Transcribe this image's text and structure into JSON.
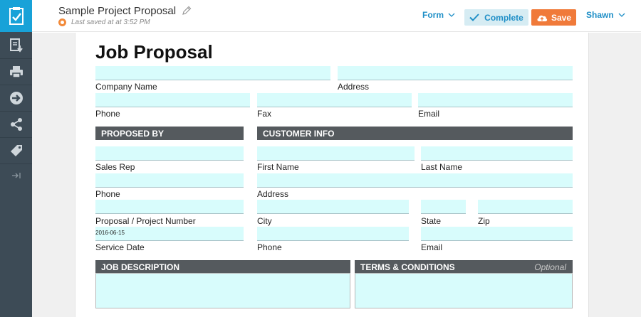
{
  "app": {
    "brand_color": "#18a2d8",
    "sidebar_color": "#3d4b56",
    "field_color": "#d8fcfc"
  },
  "sidebar": {
    "items": [
      {
        "icon": "document-download-icon"
      },
      {
        "icon": "printer-icon"
      },
      {
        "icon": "forward-arrow-icon"
      },
      {
        "icon": "share-icon"
      },
      {
        "icon": "tag-icon"
      }
    ]
  },
  "header": {
    "doc_title": "Sample Project Proposal",
    "last_saved": "Last saved at at 3:52 PM",
    "form_menu": "Form",
    "complete_label": "Complete",
    "save_label": "Save",
    "user_menu": "Shawn"
  },
  "form": {
    "title": "Job Proposal",
    "labels": {
      "company_name": "Company Name",
      "address": "Address",
      "phone": "Phone",
      "fax": "Fax",
      "email": "Email",
      "sales_rep": "Sales Rep",
      "rep_phone": "Phone",
      "proposal_number": "Proposal / Project Number",
      "service_date": "Service Date",
      "first_name": "First Name",
      "last_name": "Last Name",
      "cust_address": "Address",
      "city": "City",
      "state": "State",
      "zip": "Zip",
      "cust_phone": "Phone",
      "cust_email": "Email"
    },
    "values": {
      "service_date": "2016-06-15"
    },
    "sections": {
      "proposed_by": "PROPOSED BY",
      "customer_info": "CUSTOMER INFO",
      "job_description": "JOB DESCRIPTION",
      "terms": "TERMS & CONDITIONS",
      "terms_optional": "Optional"
    }
  }
}
